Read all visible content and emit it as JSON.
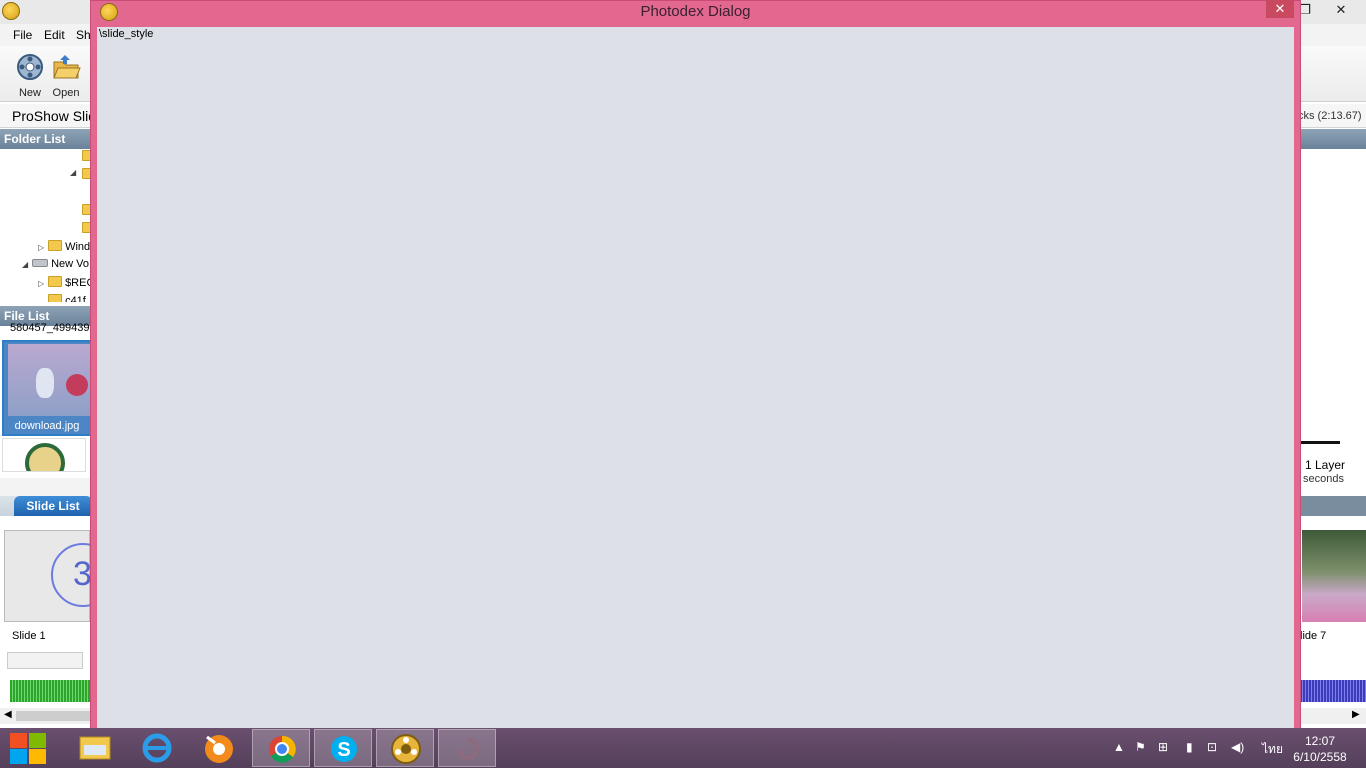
{
  "app": {
    "menu": [
      "File",
      "Edit",
      "Sh"
    ],
    "toolbar": {
      "new_label": "New",
      "open_label": "Open"
    },
    "header_title": "ProShow Slid",
    "header_right": "cks (2:13.67)",
    "folder_list_title": "Folder List",
    "folder_tree": [
      {
        "label": "Wind",
        "type": "folder"
      },
      {
        "label": "New Vo",
        "type": "drive"
      },
      {
        "label": "$REC",
        "type": "folder"
      },
      {
        "label": "c41f",
        "type": "folder"
      }
    ],
    "file_list_title": "File List",
    "file_top_name": "580457_499439",
    "selected_file": "download.jpg",
    "slide_list_tab": "Slide List",
    "slide1_number": "3",
    "slide1_label": "Slide 1",
    "slide7_label": "lide 7",
    "layers_label": "1 Layer",
    "seconds_label": "seconds"
  },
  "dialog": {
    "title": "Photodex Dialog",
    "close_glyph": "✕",
    "content_text": "\\slide_style"
  },
  "window_controls": {
    "restore": "❐",
    "close": "✕"
  },
  "taskbar": {
    "apps": [
      "start",
      "file-explorer",
      "internet-explorer",
      "media-player",
      "chrome",
      "skype",
      "proshow",
      "loading-app"
    ],
    "language": "ไทย",
    "time": "12:07",
    "date": "6/10/2558"
  },
  "colors": {
    "dialog_frame": "#e2688f",
    "dialog_client": "#dde0e7",
    "taskbar": "#5e4764",
    "section_header": "#7a90a6"
  }
}
